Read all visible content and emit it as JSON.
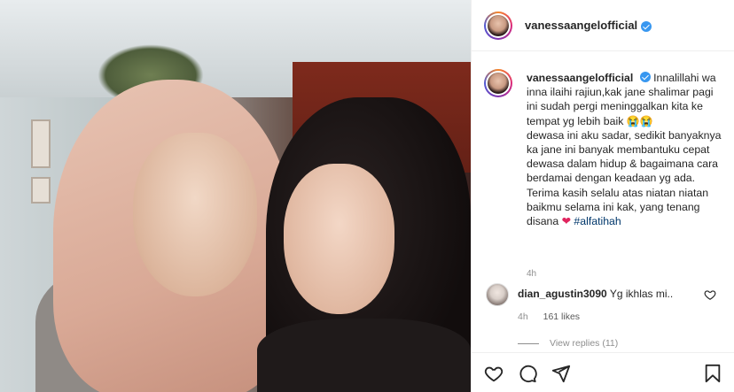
{
  "post": {
    "username": "vanessaangelofficial",
    "caption_username": "vanessaangelofficial",
    "caption_text": "Innalillahi wa inna ilaihi rajiun,kak jane shalimar pagi ini sudah pergi meninggalkan kita ke tempat yg lebih baik",
    "caption_emoji": "😭😭",
    "caption_text_2": "dewasa ini aku sadar, sedikit banyaknya ka jane ini banyak membantuku cepat dewasa dalam hidup & bagaimana cara berdamai dengan keadaan yg ada.",
    "caption_text_3": "Terima kasih selalu atas niatan niatan baikmu selama ini kak, yang tenang disana",
    "heart_emoji": "❤",
    "hashtag": "#alfatihah",
    "caption_time": "4h"
  },
  "comment": {
    "username": "dian_agustin3090",
    "text": "Yg ikhlas mi..",
    "time": "4h",
    "likes": "161 likes",
    "view_replies": "View replies (11)"
  },
  "colors": {
    "verified": "#3897f0",
    "hashtag": "#00376b",
    "heart": "#e0245e",
    "meta_gray": "#8e8e8e"
  },
  "icons": [
    "verified-badge-icon",
    "heart-icon",
    "comment-icon",
    "share-icon",
    "bookmark-icon",
    "comment-like-icon"
  ]
}
